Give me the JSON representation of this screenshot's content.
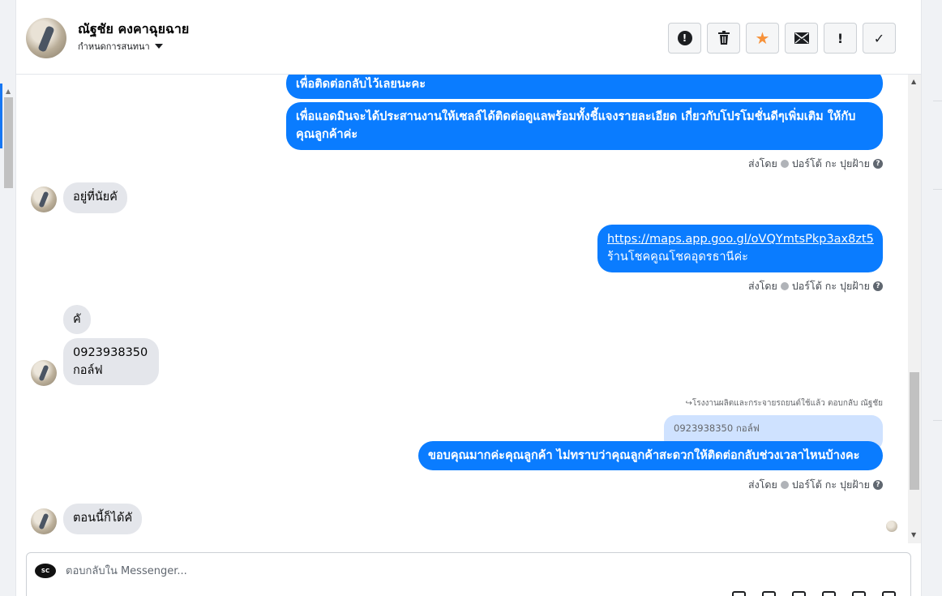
{
  "header": {
    "contact_name": "ณัฐชัย คงคาฉุยฉาย",
    "assign_label": "กำหนดการสนทนา",
    "toolbar": [
      {
        "name": "spam-button",
        "icon": "alert-circle-icon",
        "glyph": "!"
      },
      {
        "name": "delete-button",
        "icon": "trash-icon",
        "glyph": "🗑"
      },
      {
        "name": "star-button",
        "icon": "star-icon",
        "glyph": "★"
      },
      {
        "name": "mark-unread-button",
        "icon": "envelope-icon",
        "glyph": "✉"
      },
      {
        "name": "follow-up-button",
        "icon": "exclamation-icon",
        "glyph": "!"
      },
      {
        "name": "done-button",
        "icon": "check-icon",
        "glyph": "✓"
      }
    ]
  },
  "messages": {
    "out_1": "เพื่อติดต่อกลับไว้เลยนะคะ",
    "out_2": "เพื่อแอดมินจะได้ประสานงานให้เซลล์ได้ติดต่อดูแลพร้อมทั้งชี้แจงรายละเอียด เกี่ยวกับโปรโมชั่นดีๆเพิ่มเติม ให้กับคุณลูกค้าค่ะ",
    "sent_by_1": "ส่งโดย",
    "sender_1": "ปอร์โต้ กะ ปุยฝ้าย",
    "in_1": "อยู่ที่นัยคั",
    "out_3_link": "https://maps.app.goo.gl/oVQYmtsPkp3ax8zt5",
    "out_3_text": "ร้านโชคคูณโชคอุดรธานีค่ะ",
    "sent_by_2": "ส่งโดย",
    "sender_2": "ปอร์โต้ กะ ปุยฝ้าย",
    "in_2": "คั",
    "in_3_line1": "0923938350",
    "in_3_line2": "กอล์ฟ",
    "reply_note": "↪โรงงานผลิตและกระจายรถยนต์ใช้แล้ว ตอบกลับ ณัฐชัย",
    "quoted_text": "0923938350 กอล์ฟ",
    "out_4": "ขอบคุณมากค่ะคุณลูกค้า ไม่ทราบว่าคุณลูกค้าสะดวกให้ติดต่อกลับช่วงเวลาไหนบ้างคะ",
    "sent_by_3": "ส่งโดย",
    "sender_3": "ปอร์โต้ กะ ปุยฝ้าย",
    "in_4": "ตอนนี้ก็ได้คั"
  },
  "composer": {
    "placeholder": "ตอบกลับใน Messenger...",
    "page_logo_text": "SC"
  },
  "colors": {
    "outgoing_bubble": "#0a7cff",
    "incoming_bubble": "#e4e6eb",
    "quoted_bubble": "#cfe2ff",
    "star": "#f7923a"
  }
}
